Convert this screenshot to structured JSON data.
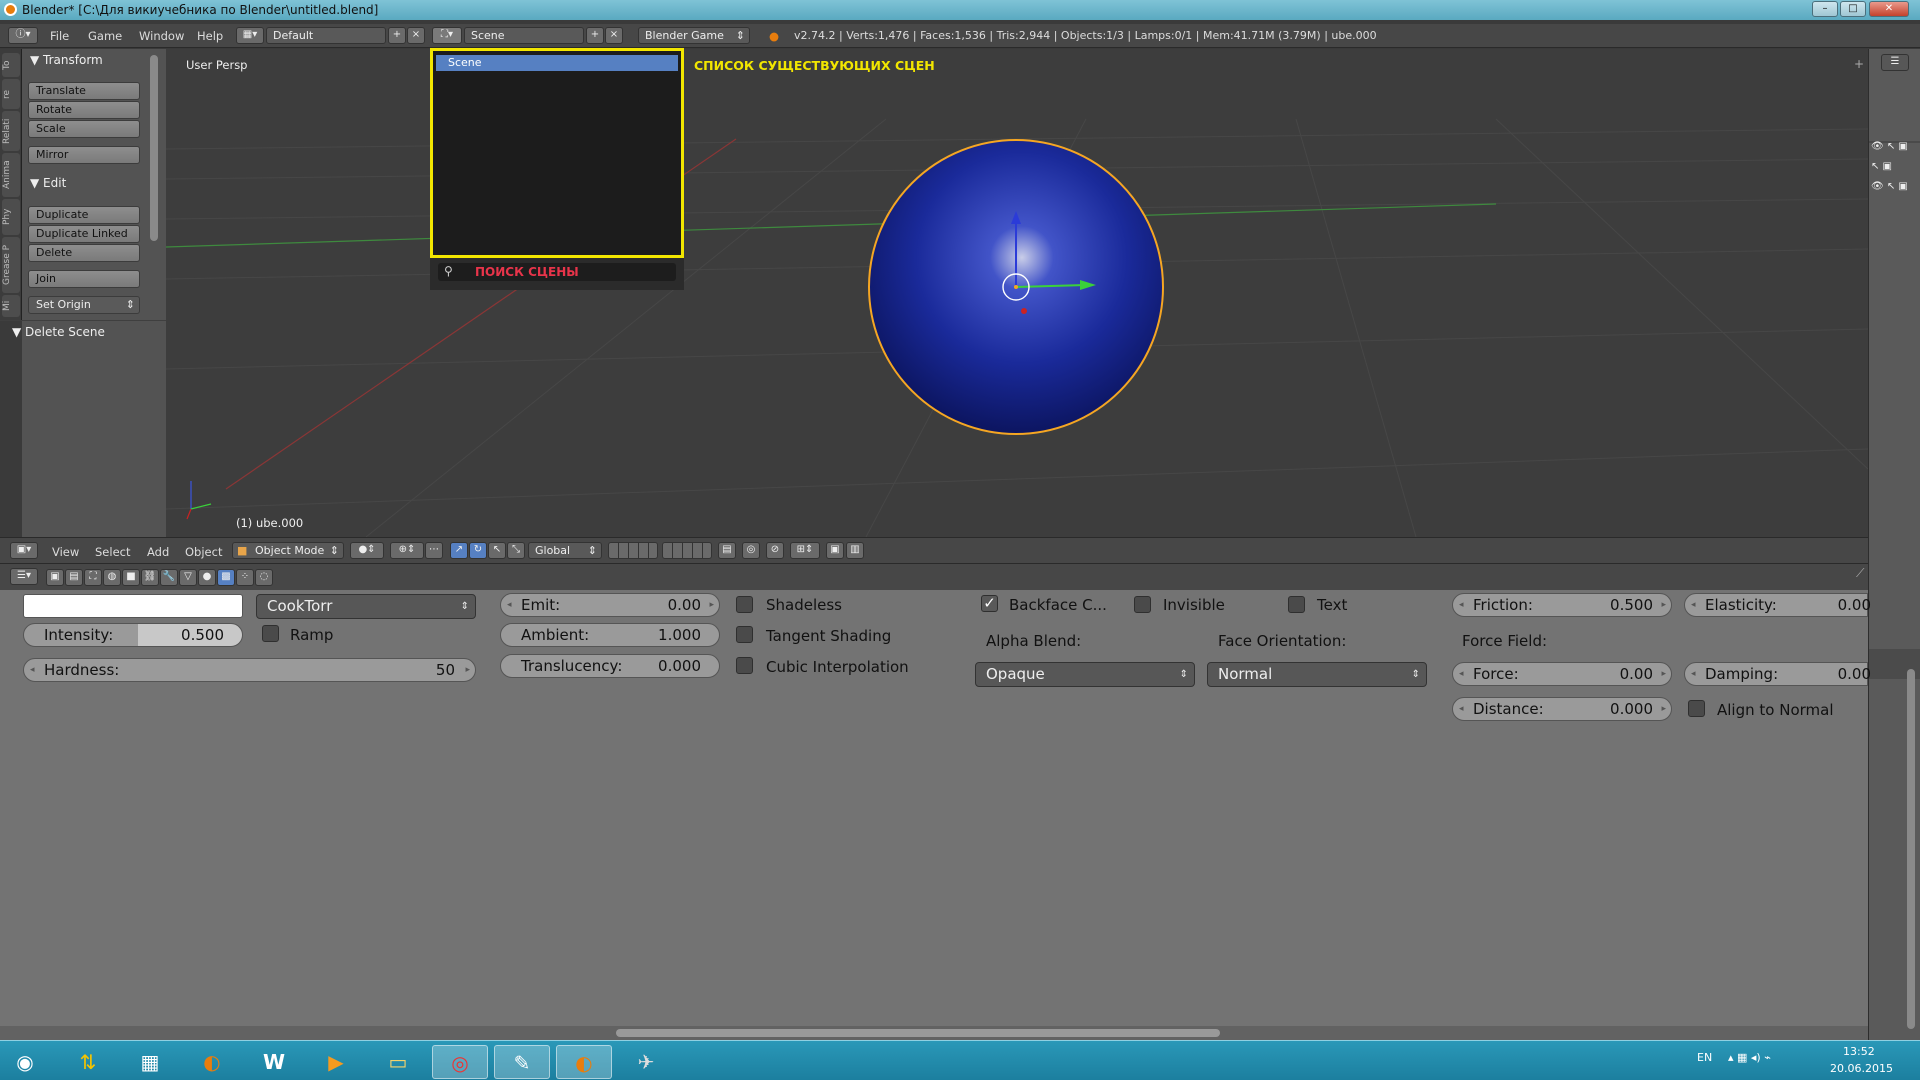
{
  "window": {
    "title": "Blender* [C:\\Для викиучебника по Blender\\untitled.blend]",
    "min": "–",
    "max": "□",
    "close": "✕"
  },
  "info_bar": {
    "menus": [
      "File",
      "Game",
      "Window",
      "Help"
    ],
    "layout": "Default",
    "scene": "Scene",
    "engine": "Blender Game",
    "stats": "v2.74.2 | Verts:1,476 | Faces:1,536 | Tris:2,944 | Objects:1/3 | Lamps:0/1 | Mem:41.71M (3.79M) | ube.000"
  },
  "scene_popup": {
    "items": [
      "Scene"
    ],
    "search_label": "ПОИСК СЦЕНЫ",
    "annotation": "СПИСОК СУЩЕСТВУЮЩИХ СЦЕН",
    "border_color": "#f2e600",
    "search_color": "#e8344a"
  },
  "left_tabs": [
    "To",
    "re",
    "Relati",
    "Anima",
    "Phy",
    "Grease P",
    "Mi"
  ],
  "toolshelf": {
    "transform_header": "Transform",
    "transform_buttons": [
      "Translate",
      "Rotate",
      "Scale",
      "Mirror"
    ],
    "edit_header": "Edit",
    "edit_buttons": [
      "Duplicate",
      "Duplicate Linked",
      "Delete",
      "Join"
    ],
    "set_origin": "Set Origin",
    "operator_header": "Delete Scene"
  },
  "viewport": {
    "label": "User Persp",
    "object_label": "(1)  ube.000",
    "sphere_color": "#1a2a9a",
    "outline_color": "#f5a623"
  },
  "viewport_toolbar": {
    "menus": [
      "View",
      "Select",
      "Add",
      "Object"
    ],
    "mode": "Object Mode",
    "orientation": "Global"
  },
  "material": {
    "color_swatch": "#ffffff",
    "specular_shader": "CookTorr",
    "intensity_label": "Intensity:",
    "intensity_value": "0.500",
    "ramp": "Ramp",
    "hardness_label": "Hardness:",
    "hardness_value": "50",
    "emit_label": "Emit:",
    "emit_value": "0.00",
    "ambient_label": "Ambient:",
    "ambient_value": "1.000",
    "translucency_label": "Translucency:",
    "translucency_value": "0.000",
    "shadeless": "Shadeless",
    "tangent_shading": "Tangent Shading",
    "cubic_interpolation": "Cubic Interpolation",
    "backface_culling": "Backface C...",
    "invisible": "Invisible",
    "text": "Text",
    "alpha_blend_label": "Alpha Blend:",
    "alpha_blend_value": "Opaque",
    "face_orientation_label": "Face Orientation:",
    "face_orientation_value": "Normal",
    "friction_label": "Friction:",
    "friction_value": "0.500",
    "elasticity_label": "Elasticity:",
    "elasticity_value": "0.00",
    "force_field_label": "Force Field:",
    "force_label": "Force:",
    "force_value": "0.00",
    "damping_label": "Damping:",
    "damping_value": "0.00",
    "distance_label": "Distance:",
    "distance_value": "0.000",
    "align_to_normal": "Align to Normal"
  },
  "taskbar": {
    "language": "EN",
    "time": "13:52",
    "date": "20.06.2015",
    "start_icon": "windows-start-icon",
    "apps": [
      "torrent-icon",
      "apps-icon",
      "blender-icon",
      "word-icon",
      "media-player-icon",
      "file-explorer-icon",
      "chrome-icon",
      "paint-icon",
      "blender-active-icon",
      "game-icon"
    ]
  }
}
